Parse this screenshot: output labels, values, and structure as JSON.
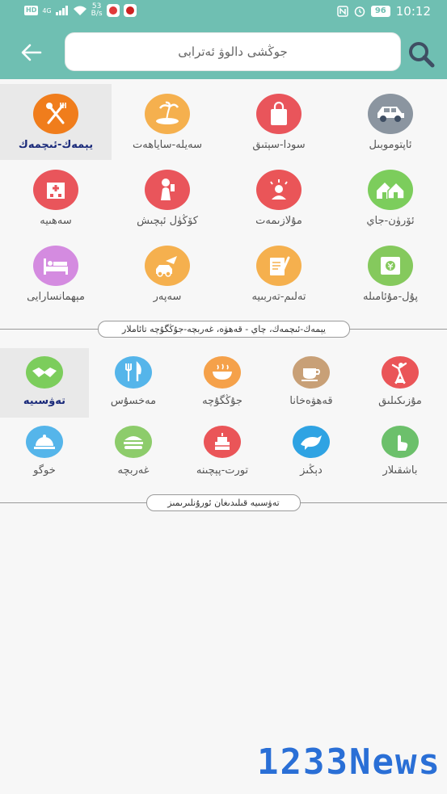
{
  "status_bar": {
    "hd_badge": "HD",
    "network": "4G",
    "speed_value": "53",
    "speed_unit": "B/s",
    "battery": "96",
    "time": "10:12"
  },
  "header": {
    "search_text": "جوڭشى دالوۋ ئەترابى"
  },
  "colors": {
    "accent": "#6fbfb2"
  },
  "categories": [
    {
      "label": "ئاپتوموبىل",
      "icon": "car-icon",
      "color": "#8b95a0"
    },
    {
      "label": "سودا-سېتىق",
      "icon": "shopping-bag-icon",
      "color": "#e9555b"
    },
    {
      "label": "سەيلە-ساياھەت",
      "icon": "island-icon",
      "color": "#f5b04e"
    },
    {
      "label": "يېمەك-ئىچمەك",
      "icon": "fork-spoon-icon",
      "color": "#f07d1c"
    },
    {
      "label": "ئۆرۈن-جاي",
      "icon": "houses-icon",
      "color": "#7ccd5c"
    },
    {
      "label": "مۇلازىمەت",
      "icon": "service-person-icon",
      "color": "#ea5558"
    },
    {
      "label": "كۆڭۈل ئېچىش",
      "icon": "drinking-person-icon",
      "color": "#e9555b"
    },
    {
      "label": "سەھىيە",
      "icon": "hospital-icon",
      "color": "#e9555b"
    },
    {
      "label": "پۇل-مۇئامىلە",
      "icon": "money-icon",
      "color": "#85c95d"
    },
    {
      "label": "تەلىم-تەربىيە",
      "icon": "book-pencil-icon",
      "color": "#f5b04e"
    },
    {
      "label": "سەپەر",
      "icon": "car-plane-icon",
      "color": "#f5b04e"
    },
    {
      "label": "مېھمانسارايى",
      "icon": "bed-icon",
      "color": "#d48be0"
    }
  ],
  "section_title": "يېمەك-ئىچمەك، چاي - قەھۋە، غەربچە-جۇڭگۇچە تائاملار",
  "subcategories": [
    {
      "label": "مۇزىكىلىق",
      "icon": "dancer-icon",
      "color": "#ea5558"
    },
    {
      "label": "قەھۋەخانا",
      "icon": "coffee-cup-icon",
      "color": "#c8a077"
    },
    {
      "label": "جۇڭگۇچە",
      "icon": "hot-pot-icon",
      "color": "#f5a14a"
    },
    {
      "label": "مەخسۇس",
      "icon": "fork-knife-icon",
      "color": "#55b5ea"
    },
    {
      "label": "تەۋسىيە",
      "icon": "handshake-icon",
      "color": "#7ccd5c"
    },
    {
      "label": "باشقىلار",
      "icon": "tap-hand-icon",
      "color": "#6cc06b"
    },
    {
      "label": "دېڭىز",
      "icon": "dolphin-icon",
      "color": "#2fa3e3"
    },
    {
      "label": "تورت-پېچىنە",
      "icon": "cake-icon",
      "color": "#ea5558"
    },
    {
      "label": "غەربچە",
      "icon": "burger-icon",
      "color": "#8dcc6b"
    },
    {
      "label": "خوگو",
      "icon": "cloche-icon",
      "color": "#55b5ea"
    }
  ],
  "recommend_title": "تەۋسىيە قىلىدىغان ئورۇنلىرىمىز",
  "watermark": "1233News"
}
